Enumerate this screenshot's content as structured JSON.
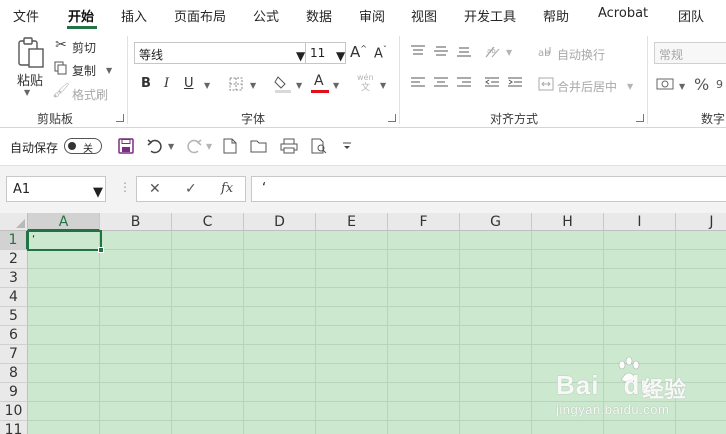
{
  "menu": {
    "tabs": [
      {
        "label": "文件"
      },
      {
        "label": "开始",
        "active": true
      },
      {
        "label": "插入"
      },
      {
        "label": "页面布局"
      },
      {
        "label": "公式"
      },
      {
        "label": "数据"
      },
      {
        "label": "审阅"
      },
      {
        "label": "视图"
      },
      {
        "label": "开发工具"
      },
      {
        "label": "帮助"
      },
      {
        "label": "Acrobat"
      },
      {
        "label": "团队"
      }
    ]
  },
  "ribbon": {
    "clipboard": {
      "paste_label": "粘贴",
      "cut_label": "剪切",
      "copy_label": "复制",
      "format_painter_label": "格式刷",
      "group_label": "剪贴板"
    },
    "font": {
      "font_name": "等线",
      "font_size": "11",
      "bold": "B",
      "italic": "I",
      "underline": "U",
      "font_color_glyph": "A",
      "grow_glyph": "A",
      "shrink_glyph": "A",
      "phonetic_glyph": "wén",
      "group_label": "字体"
    },
    "alignment": {
      "wrap_text_label": "自动换行",
      "merge_center_label": "合并后居中",
      "group_label": "对齐方式"
    },
    "number": {
      "format_value": "常规",
      "percent_glyph": "%",
      "group_label": "数字"
    }
  },
  "quick_access": {
    "autosave_label": "自动保存",
    "autosave_state": "关"
  },
  "formula_bar": {
    "name_box": "A1",
    "cancel_glyph": "✕",
    "enter_glyph": "✓",
    "fx_glyph": "fx",
    "content": "‘"
  },
  "grid": {
    "columns": [
      "A",
      "B",
      "C",
      "D",
      "E",
      "F",
      "G",
      "H",
      "I",
      "J"
    ],
    "rows": [
      "1",
      "2",
      "3",
      "4",
      "5",
      "6",
      "7",
      "8",
      "9",
      "10",
      "11"
    ],
    "selected_column": "A",
    "selected_row": "1",
    "active_cell_value": "‘",
    "cell_color": "#cce8cf",
    "accent_color": "#217346"
  },
  "watermark": {
    "brand": "Bai",
    "brand_suffix": "du",
    "chinese": "经验",
    "url": "jingyan.baidu.com"
  }
}
